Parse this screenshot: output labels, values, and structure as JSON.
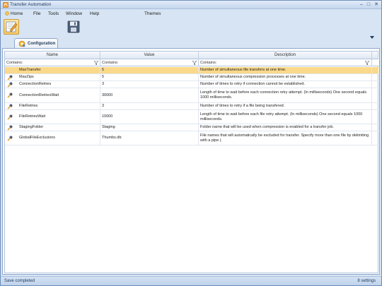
{
  "window": {
    "title": "Transfer Automation",
    "min_glyph": "–",
    "max_glyph": "□",
    "close_glyph": "✕"
  },
  "menu": {
    "home": "Home",
    "file": "File",
    "tools": "Tools",
    "window": "Window",
    "help": "Help",
    "themes": "Themes"
  },
  "tabs": [
    {
      "label": "Configuration"
    }
  ],
  "grid": {
    "columns": [
      "Name",
      "Value",
      "Description"
    ],
    "filters": [
      "Contains:",
      "Contains:",
      "Contains:"
    ],
    "rows": [
      {
        "name": "MaxTransfer",
        "value": "5",
        "description": "Number of simultaneous file transfers at one time."
      },
      {
        "name": "MaxZips",
        "value": "5",
        "description": "Number of simultaneous compression processes at one time."
      },
      {
        "name": "ConnectionRetries",
        "value": "3",
        "description": "Number of times to retry if connection cannot be established."
      },
      {
        "name": "ConnectionRetriesWait",
        "value": "30000",
        "description": "Length of time to wait before each connection retry attempt. (In milliseconds) One second equals 1000 milliseconds."
      },
      {
        "name": "FileRetries",
        "value": "3",
        "description": "Number of times to retry if a file being transfered."
      },
      {
        "name": "FileRetriesWait",
        "value": "10000",
        "description": "Length of time to wait before each file retry attempt. (In milliseconds) One second equals 1000 milliseconds."
      },
      {
        "name": "StagingFolder",
        "value": "Staging",
        "description": "Folder name that will be used when compression is enabled for a transfer job."
      },
      {
        "name": "GlobalFileExclusions",
        "value": "Thumbs.db",
        "description": "File names that will automatically be excluded for transfer. Specify more than one file by delimiting with a pipe |."
      }
    ]
  },
  "status": {
    "left": "Save completed",
    "right": "8 settings"
  },
  "colors": {
    "selected_row": "#fbd98a",
    "chrome": "#d7e4f3"
  }
}
